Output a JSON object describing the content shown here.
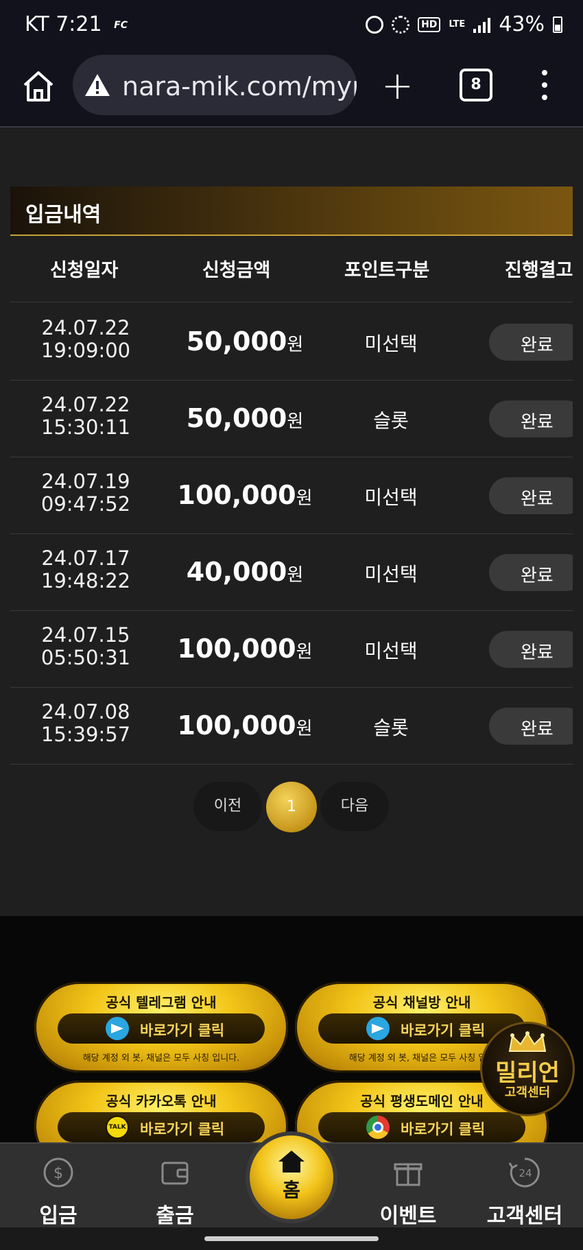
{
  "status_bar": {
    "time": "KT 7:21",
    "carrier_logo": "FC",
    "hd": "HD",
    "lte": "LTE",
    "battery": "43%"
  },
  "browser": {
    "url": "nara-mik.com/myp",
    "tab_count": "8"
  },
  "deposits": {
    "title": "입금내역",
    "columns": [
      "신청일자",
      "신청금액",
      "포인트구분",
      "진행결고"
    ],
    "rows": [
      {
        "date": "24.07.22",
        "time": "19:09:00",
        "amount": "50,000",
        "unit": "원",
        "point": "미선택",
        "status": "완료"
      },
      {
        "date": "24.07.22",
        "time": "15:30:11",
        "amount": "50,000",
        "unit": "원",
        "point": "슬롯",
        "status": "완료"
      },
      {
        "date": "24.07.19",
        "time": "09:47:52",
        "amount": "100,000",
        "unit": "원",
        "point": "미선택",
        "status": "완료"
      },
      {
        "date": "24.07.17",
        "time": "19:48:22",
        "amount": "40,000",
        "unit": "원",
        "point": "미선택",
        "status": "완료"
      },
      {
        "date": "24.07.15",
        "time": "05:50:31",
        "amount": "100,000",
        "unit": "원",
        "point": "미선택",
        "status": "완료"
      },
      {
        "date": "24.07.08",
        "time": "15:39:57",
        "amount": "100,000",
        "unit": "원",
        "point": "슬롯",
        "status": "완료"
      }
    ]
  },
  "pagination": {
    "prev": "이전",
    "current": "1",
    "next": "다음"
  },
  "promos": [
    {
      "title": "공식 텔레그램 안내",
      "button": "바로가기 클릭",
      "note": "해당 계정 외 봇, 채널은 모두 사칭 입니다.",
      "icon": "telegram-icon"
    },
    {
      "title": "공식 채널방 안내",
      "button": "바로가기 클릭",
      "note": "해당 계정 외 봇, 채널은 모두 사칭 입니",
      "icon": "telegram-icon"
    },
    {
      "title": "공식 카카오톡 안내",
      "button": "바로가기 클릭",
      "note": "",
      "icon": "kakaotalk-icon",
      "icon_text": "TALK"
    },
    {
      "title": "공식 평생도메인 안내",
      "button": "바로가기 클릭",
      "note": "",
      "icon": "chrome-icon"
    }
  ],
  "support_badge": {
    "line1": "밀리언",
    "line2": "고객센터"
  },
  "bottom_nav": {
    "deposit": "입금",
    "withdraw": "출금",
    "home": "홈",
    "event": "이벤트",
    "support": "고객센터",
    "support_icon_text": "24"
  },
  "colors": {
    "accent_gold": "#f2c417",
    "background": "#1f1f1f",
    "header_bar": "#12121c"
  }
}
